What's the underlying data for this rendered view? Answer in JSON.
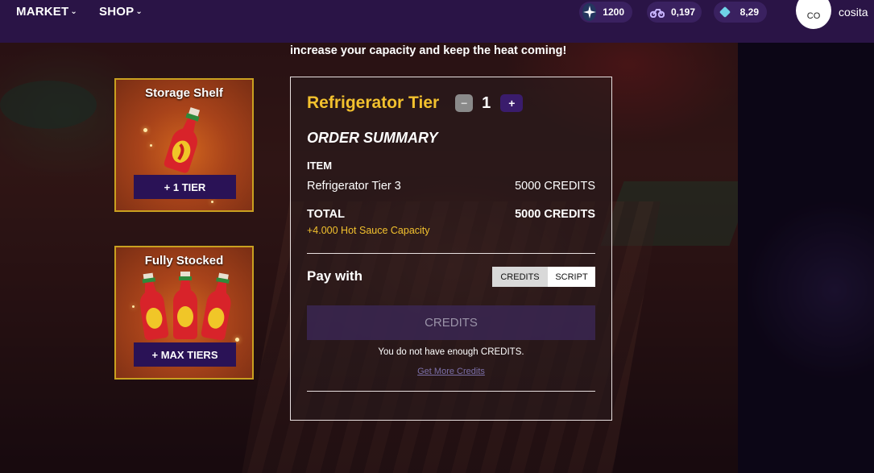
{
  "nav": {
    "market_label": "MARKET",
    "shop_label": "SHOP",
    "chevron": "⌄"
  },
  "stats": {
    "stars": {
      "icon": "star-icon",
      "value": "1200"
    },
    "bikes": {
      "icon": "motorbike-icon",
      "value": "0,197"
    },
    "gems": {
      "icon": "gem-icon",
      "value": "8,29"
    }
  },
  "user": {
    "avatar_initials": "CO",
    "name": "cosita"
  },
  "intro_text": "increase your capacity and keep the heat coming!",
  "upgrades": [
    {
      "title": "Storage Shelf",
      "button": "+ 1 TIER"
    },
    {
      "title": "Fully Stocked",
      "button": "+ MAX TIERS"
    }
  ],
  "order": {
    "tier_title": "Refrigerator Tier",
    "quantity": "1",
    "minus_label": "−",
    "plus_label": "+",
    "summary_heading": "ORDER SUMMARY",
    "item_label": "ITEM",
    "item_name": "Refrigerator Tier 3",
    "item_price": "5000 CREDITS",
    "total_label": "TOTAL",
    "total_value": "5000 CREDITS",
    "capacity_note": "+4.000 Hot Sauce Capacity",
    "pay_with_label": "Pay with",
    "pay_options": [
      "CREDITS",
      "SCRIPT"
    ],
    "buy_button": "CREDITS",
    "warning": "You do not have enough CREDITS.",
    "more_link": "Get More Credits"
  },
  "colors": {
    "nav_bg": "#2a1446",
    "accent_gold": "#f2c12e",
    "button_purple": "#2a1256"
  }
}
